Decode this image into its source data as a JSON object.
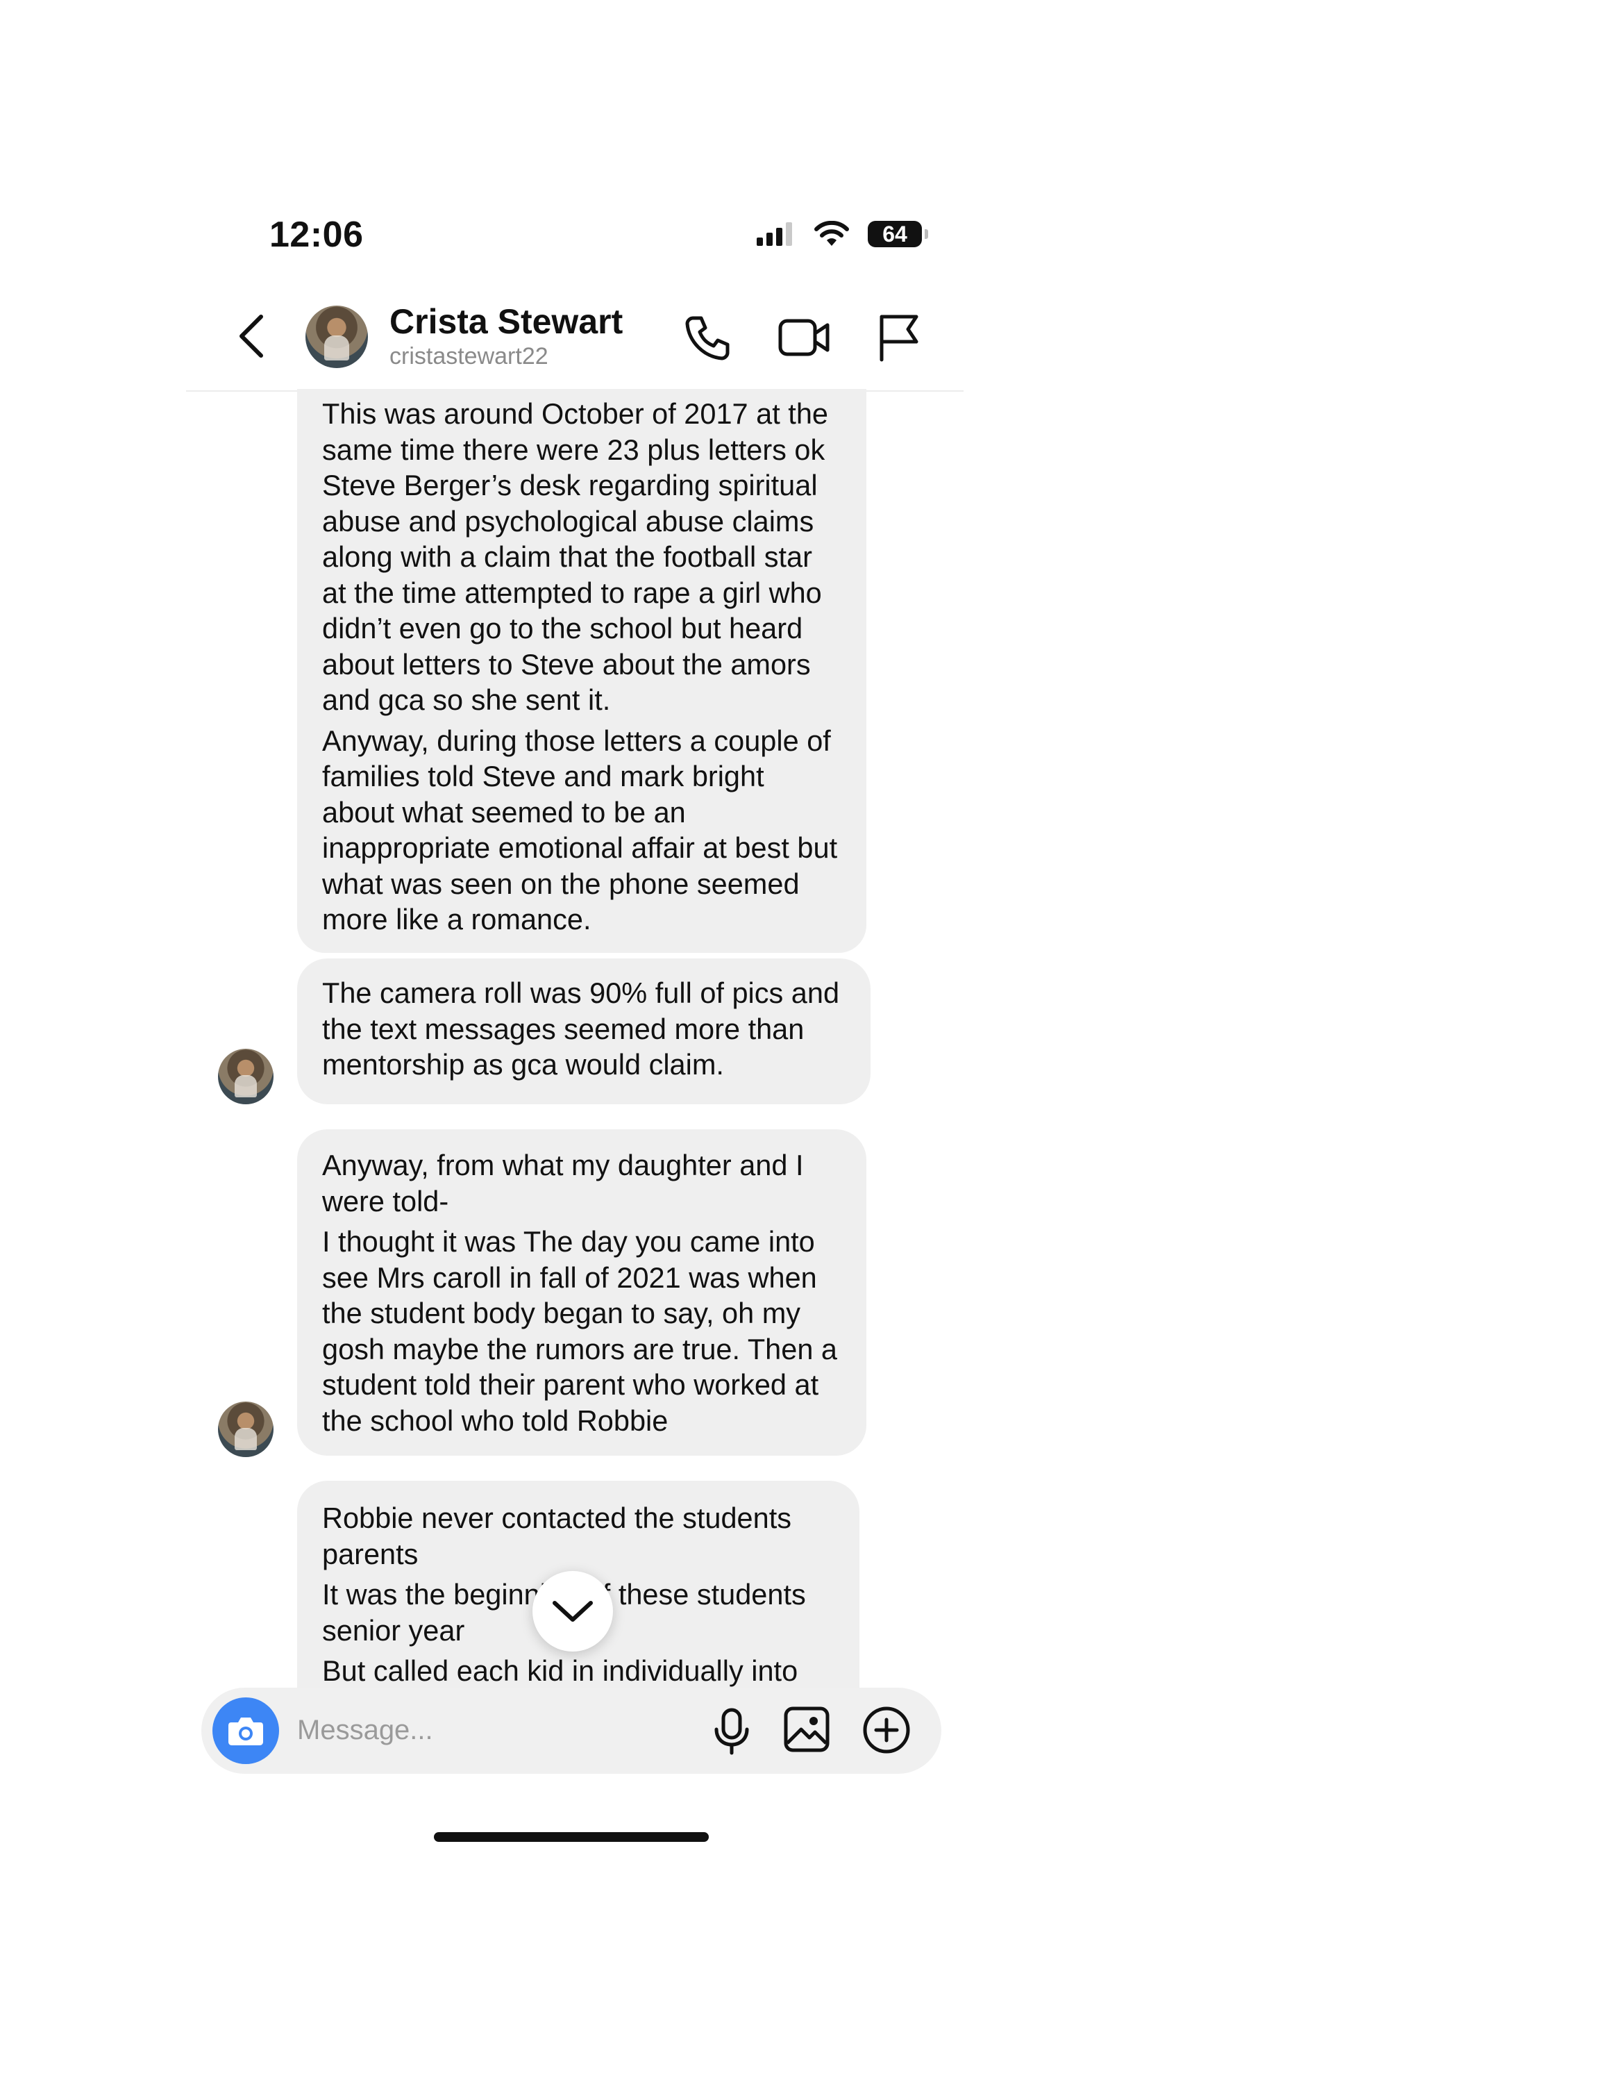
{
  "status": {
    "time": "12:06",
    "battery": "64"
  },
  "header": {
    "name": "Crista Stewart",
    "handle": "cristastewart22"
  },
  "messages": [
    {
      "paragraphs": [
        "This was around October of 2017 at the same time there were 23 plus letters ok Steve Berger’s desk regarding spiritual abuse and psychological abuse claims along with a claim that the football star at the time attempted to rape a girl who didn’t even go to the school but heard about letters to Steve about the amors and gca so she sent it.",
        "Anyway, during those letters a couple of families told Steve and mark bright about what seemed to be an inappropriate emotional affair at best but what was seen on the phone seemed more like a romance."
      ]
    },
    {
      "paragraphs": [
        "The camera roll was 90% full of pics and the text messages seemed more than mentorship as gca would claim."
      ]
    },
    {
      "paragraphs": [
        "Anyway, from what my daughter and I were told-",
        "I thought it was The day you came into see Mrs caroll in fall of 2021 was when the student body began to say, oh my gosh maybe the rumors are true. Then a student told their parent who worked at the school who told Robbie"
      ]
    },
    {
      "paragraphs": [
        "Robbie never contacted the students parents",
        "It was the beginning of these students senior year",
        "But called each kid in individually into"
      ]
    }
  ],
  "composer": {
    "placeholder": "Message..."
  },
  "icons": {
    "back": "chevron-left-icon",
    "call": "phone-icon",
    "video": "video-camera-icon",
    "report": "flag-icon",
    "camera": "camera-icon",
    "mic": "microphone-icon",
    "gallery": "image-icon",
    "add": "plus-circle-icon",
    "scroll": "chevron-down-icon"
  },
  "colors": {
    "bubble": "#efefef",
    "accent": "#3d86f5",
    "composer": "#f0f0f0"
  }
}
